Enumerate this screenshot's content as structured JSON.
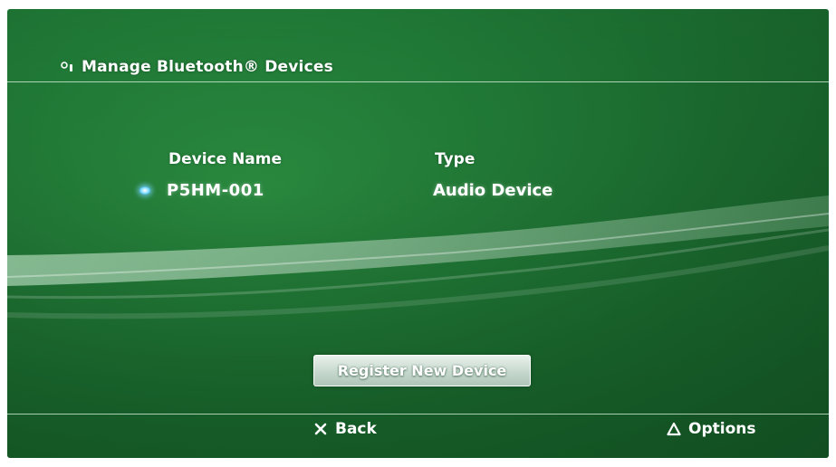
{
  "header": {
    "icon": "bluetooth-device-icon",
    "title": "Manage Bluetooth® Devices"
  },
  "columns": {
    "name_header": "Device Name",
    "type_header": "Type"
  },
  "devices": [
    {
      "name": "P5HM-001",
      "type": "Audio Device",
      "selected": true
    }
  ],
  "actions": {
    "register_label": "Register New Device"
  },
  "footer": {
    "back_icon": "cross-button-icon",
    "back_label": "Back",
    "options_icon": "triangle-button-icon",
    "options_label": "Options"
  },
  "colors": {
    "background": "#23813a",
    "selection": "#3fb7ee",
    "text": "#ffffff"
  }
}
